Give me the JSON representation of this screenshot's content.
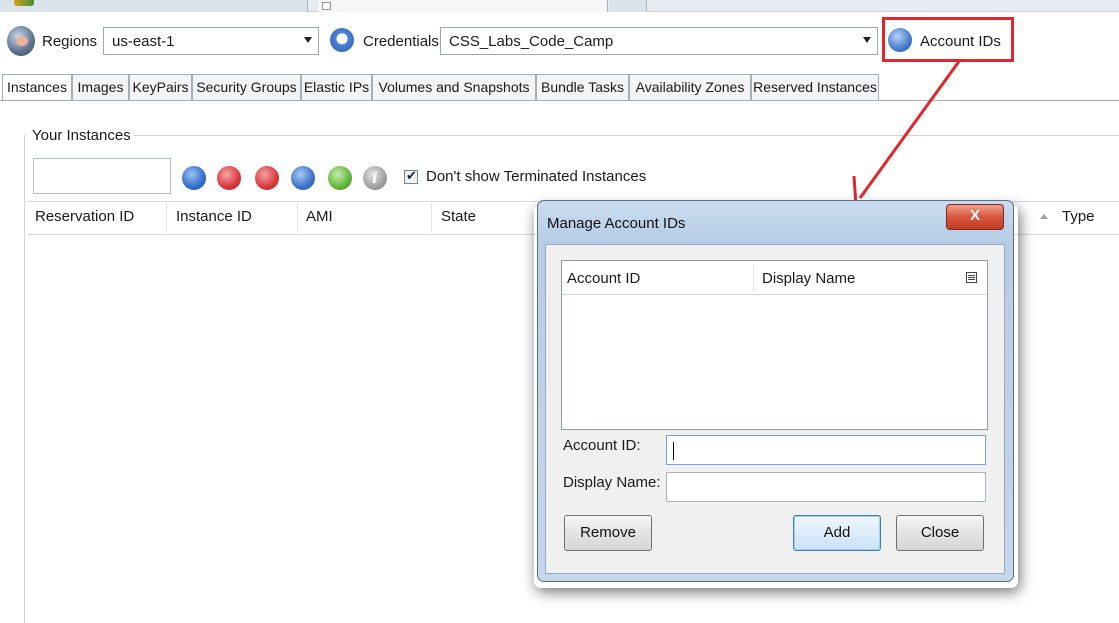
{
  "toolbar": {
    "regions_label": "Regions",
    "region_value": "us-east-1",
    "credentials_label": "Credentials",
    "credentials_value": "CSS_Labs_Code_Camp",
    "account_ids_label": "Account IDs"
  },
  "tabs": [
    {
      "label": "Instances"
    },
    {
      "label": "Images"
    },
    {
      "label": "KeyPairs"
    },
    {
      "label": "Security Groups"
    },
    {
      "label": "Elastic IPs"
    },
    {
      "label": "Volumes and Snapshots"
    },
    {
      "label": "Bundle Tasks"
    },
    {
      "label": "Availability Zones"
    },
    {
      "label": "Reserved Instances"
    }
  ],
  "instances": {
    "group_title": "Your Instances",
    "filter_value": "",
    "show_terminated_label": "Don't show Terminated Instances",
    "show_terminated_checked": true,
    "columns": [
      "Reservation ID",
      "Instance ID",
      "AMI",
      "State",
      "Type"
    ]
  },
  "dialog": {
    "title": "Manage Account IDs",
    "close_glyph": "X",
    "table_columns": [
      "Account ID",
      "Display Name"
    ],
    "account_id_label": "Account ID:",
    "account_id_value": "",
    "display_name_label": "Display Name:",
    "display_name_value": "",
    "remove_label": "Remove",
    "add_label": "Add",
    "close_label": "Close"
  },
  "colors": {
    "highlight": "#e3262b",
    "dialog_frame": "#b7cde6"
  },
  "icons": [
    "regions-icon",
    "credentials-icon",
    "account-ids-icon",
    "refresh-icon",
    "stop-icon",
    "power-icon",
    "database-icon",
    "key-icon",
    "info-icon",
    "checkbox-icon",
    "column-menu-icon",
    "close-icon"
  ]
}
